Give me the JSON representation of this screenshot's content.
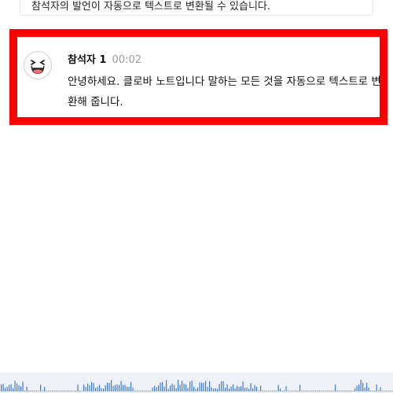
{
  "previous_message": {
    "text": "참석자의 발언이 자동으로 텍스트로 변환될 수 있습니다."
  },
  "transcript_entry": {
    "speaker": "참석자 1",
    "timestamp": "00:02",
    "message": "안녕하세요. 클로바 노트입니다 말하는 모든 것을 자동으로 텍스트로 변환해 줍니다."
  },
  "colors": {
    "highlight_border": "#ff0000",
    "waveform_bar": "#3a7bd5",
    "waveform_bg": "#eef2f7"
  }
}
